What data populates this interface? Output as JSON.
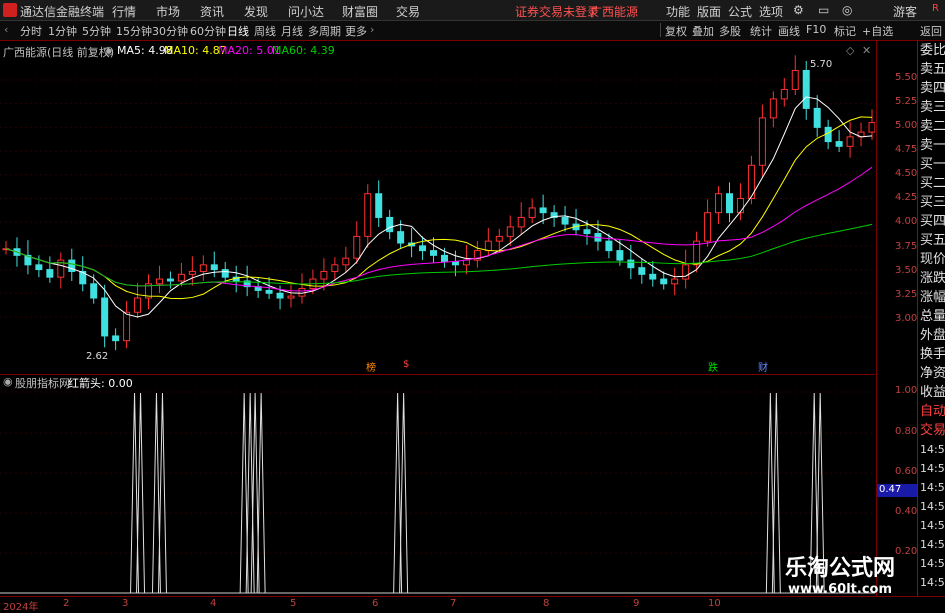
{
  "titlebar": {
    "app_name": "通达信金融终端",
    "menu": [
      "行情",
      "市场",
      "资讯",
      "发现",
      "问小达",
      "财富圈",
      "交易"
    ],
    "notice": "证券交易未登录",
    "stock": "广西能源",
    "right_menu": [
      "功能",
      "版面",
      "公式",
      "选项"
    ],
    "user": "游客"
  },
  "toolbar": {
    "periods": [
      "分时",
      "1分钟",
      "5分钟",
      "15分钟",
      "30分钟",
      "60分钟",
      "日线",
      "周线",
      "月线",
      "多周期",
      "更多"
    ],
    "active_period": "日线",
    "actions": [
      "复权",
      "叠加",
      "多股",
      "统计",
      "画线",
      "F10",
      "标记",
      "+自选",
      "返回"
    ]
  },
  "main": {
    "title": "广西能源(日线 前复权)",
    "ma": [
      {
        "label": "MA5: 4.98",
        "color": "#ffffff"
      },
      {
        "label": "MA10: 4.87",
        "color": "#ffff00"
      },
      {
        "label": "MA20: 5.01",
        "color": "#ff00ff"
      },
      {
        "label": "MA60: 4.39",
        "color": "#00cc00"
      }
    ],
    "high_label": "5.70",
    "low_label": "2.62",
    "event_tags": [
      "榜",
      "$",
      "跌",
      "财"
    ]
  },
  "indicator": {
    "title": "股朋指标网",
    "value_label": "红箭头: 0.00",
    "current_value": "0.47"
  },
  "y_axis_main": [
    "5.50",
    "5.25",
    "5.00",
    "4.75",
    "4.50",
    "4.25",
    "4.00",
    "3.75",
    "3.50",
    "3.25",
    "3.00"
  ],
  "y_axis_ind": [
    "1.00",
    "0.80",
    "0.60",
    "0.40",
    "0.20"
  ],
  "x_axis": [
    "2024年",
    "2",
    "3",
    "4",
    "5",
    "6",
    "7",
    "8",
    "9",
    "10"
  ],
  "right_panel": [
    "委比",
    "卖五",
    "卖四",
    "卖三",
    "卖二",
    "卖一",
    "买一",
    "买二",
    "买三",
    "买四",
    "买五",
    "现价",
    "涨跌",
    "涨幅",
    "总量",
    "外盘",
    "换手",
    "净资",
    "收益",
    "自动",
    "交易",
    "14:56",
    "14:56",
    "14:56",
    "14:56",
    "14:56",
    "14:56",
    "14:56",
    "14:56"
  ],
  "watermark": {
    "line1": "乐淘公式网",
    "line2": "www.60lt.com"
  },
  "chart_data": {
    "type": "bar",
    "title": "广西能源(日线 前复权)",
    "y_range": [
      2.62,
      5.7
    ],
    "candles_close": [
      3.72,
      3.65,
      3.55,
      3.5,
      3.42,
      3.6,
      3.48,
      3.35,
      3.2,
      2.8,
      2.75,
      3.05,
      3.2,
      3.35,
      3.4,
      3.38,
      3.45,
      3.48,
      3.55,
      3.5,
      3.42,
      3.38,
      3.32,
      3.28,
      3.25,
      3.2,
      3.22,
      3.3,
      3.4,
      3.48,
      3.55,
      3.62,
      3.85,
      4.3,
      4.05,
      3.9,
      3.78,
      3.75,
      3.7,
      3.65,
      3.58,
      3.55,
      3.6,
      3.7,
      3.8,
      3.85,
      3.95,
      4.05,
      4.15,
      4.1,
      4.05,
      3.98,
      3.92,
      3.88,
      3.8,
      3.7,
      3.6,
      3.52,
      3.45,
      3.4,
      3.35,
      3.4,
      3.55,
      3.8,
      4.1,
      4.3,
      4.1,
      4.25,
      4.6,
      5.1,
      5.3,
      5.4,
      5.6,
      5.2,
      5.0,
      4.85,
      4.8,
      4.9,
      4.95,
      5.05
    ],
    "signals_index": [
      12,
      14,
      22,
      23,
      36,
      70,
      74
    ]
  }
}
